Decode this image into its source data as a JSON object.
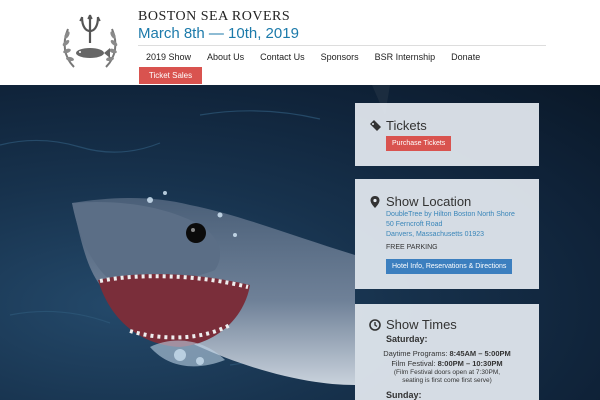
{
  "header": {
    "org_name": "BOSTON SEA ROVERS",
    "dates": "March 8th — 10th, 2019",
    "nav": [
      "2019 Show",
      "About Us",
      "Contact Us",
      "Sponsors",
      "BSR Internship",
      "Donate"
    ],
    "ticket_sales": "Ticket Sales"
  },
  "tickets": {
    "title": "Tickets",
    "button": "Purchase Tickets"
  },
  "location": {
    "title": "Show Location",
    "venue": "DoubleTree by Hilton Boston North Shore",
    "street": "50 Ferncroft Road",
    "city": "Danvers, Massachusetts 01923",
    "parking": "FREE PARKING",
    "button": "Hotel Info, Reservations & Directions"
  },
  "times": {
    "title": "Show Times",
    "saturday": "Saturday:",
    "daytime_label": "Daytime Programs:",
    "daytime_value": "8:45AM – 5:00PM",
    "film_label": "Film Festival:",
    "film_value": "8:00PM – 10:30PM",
    "note1": "(Film Festival doors open at 7:30PM,",
    "note2": "seating is first come first serve)",
    "sunday": "Sunday:"
  },
  "colors": {
    "accent_blue": "#1c7aaa",
    "button_red": "#d9534f",
    "button_blue": "#3c7fbf"
  },
  "icons": [
    "trident-logo-icon",
    "ticket-icon",
    "map-marker-icon",
    "clock-icon"
  ]
}
